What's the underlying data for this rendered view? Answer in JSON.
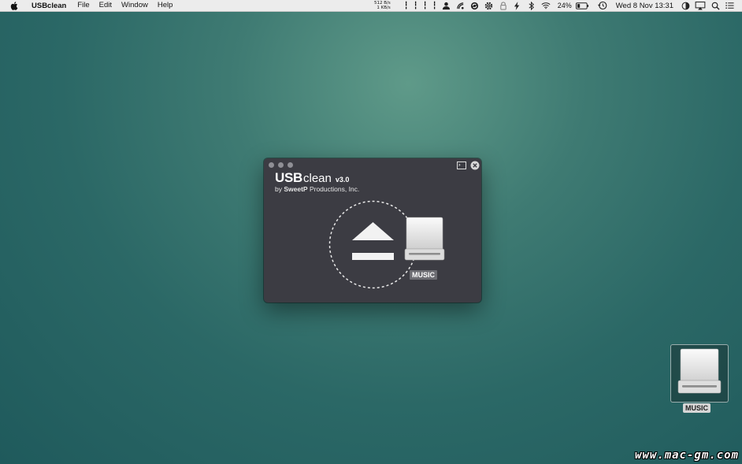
{
  "menubar": {
    "apple_icon": "apple-logo-icon",
    "app_name": "USBclean",
    "menus": [
      "File",
      "Edit",
      "Window",
      "Help"
    ],
    "net_up": "512 B/s",
    "net_down": "1 KB/s",
    "battery_percent": "24%",
    "datetime": "Wed 8 Nov  13:31"
  },
  "window": {
    "logo_usb": "USB",
    "logo_clean": "clean",
    "version": "v3.0",
    "byline_prefix": "by ",
    "byline_company": "SweetP",
    "byline_suffix": " Productions, Inc.",
    "drive_name": "MUSIC"
  },
  "desktop": {
    "icon_label": "MUSIC"
  },
  "watermark": "www.mac-gm.com",
  "colors": {
    "window_bg": "#3c3c43",
    "menubar_bg": "#ececec",
    "desktop": "#2f6d6a"
  }
}
